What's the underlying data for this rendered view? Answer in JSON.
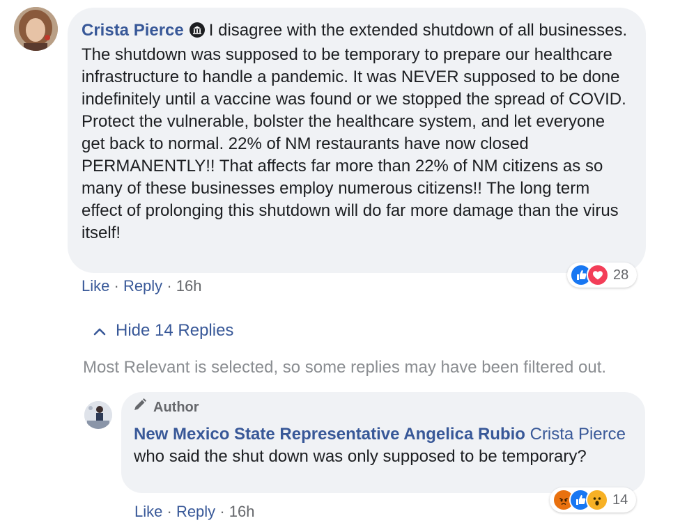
{
  "comment": {
    "author": "Crista Pierce",
    "badge_icon": "government-official-icon",
    "text": "I disagree with the extended shutdown of all businesses. The shutdown was supposed to be temporary to prepare our healthcare infrastructure to handle a pandemic. It was NEVER supposed to be done indefinitely until a vaccine was found or we stopped the spread of COVID. Protect the vulnerable, bolster the healthcare system, and let everyone get back to normal. 22% of NM restaurants have now closed PERMANENTLY!! That affects far more than 22% of NM citizens as so many of these businesses employ numerous citizens!! The long term effect of prolonging this shutdown will do far more damage than the virus itself!",
    "like_label": "Like",
    "reply_label": "Reply",
    "separator": "·",
    "time": "16h",
    "reactions": {
      "icons": [
        "like-reaction-icon",
        "love-reaction-icon"
      ],
      "count": "28"
    }
  },
  "replies_toggle": {
    "label": "Hide 14 Replies",
    "icon": "chevron-up-icon"
  },
  "filter_notice": "Most Relevant is selected, so some replies may have been filtered out.",
  "reply": {
    "author_badge": "Author",
    "author_badge_icon": "pencil-icon",
    "author": "New Mexico State Representative Angelica Rubio",
    "mention": "Crista Pierce",
    "text": "who said the shut down was only supposed to be temporary?",
    "like_label": "Like",
    "reply_label": "Reply",
    "separator": "·",
    "time": "16h",
    "reactions": {
      "icons": [
        "angry-reaction-icon",
        "like-reaction-icon",
        "wow-reaction-icon"
      ],
      "count": "14"
    }
  },
  "colors": {
    "link": "#385898",
    "bubble": "#f0f2f5",
    "meta": "#65676b",
    "like": "#1877f2",
    "love": "#f33e58",
    "angry": "#e9710f",
    "wow": "#f7b125"
  }
}
